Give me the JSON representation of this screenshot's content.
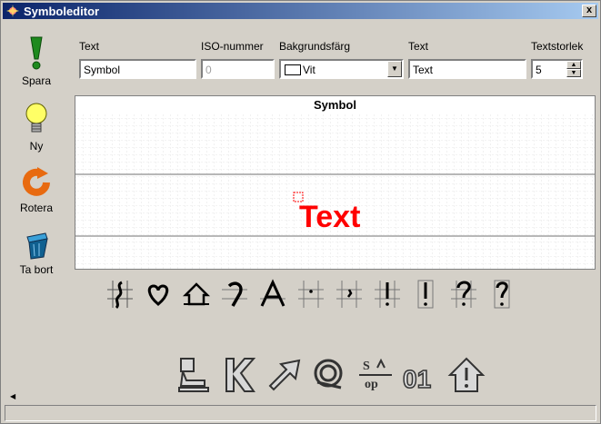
{
  "window": {
    "title": "Symboleditor",
    "close_label": "x"
  },
  "sidebar": {
    "items": [
      {
        "label": "Spara"
      },
      {
        "label": "Ny"
      },
      {
        "label": "Rotera"
      },
      {
        "label": "Ta bort"
      }
    ]
  },
  "fields": {
    "text1": {
      "label": "Text",
      "value": "Symbol"
    },
    "iso": {
      "label": "ISO-nummer",
      "value": "0"
    },
    "background": {
      "label": "Bakgrundsfärg",
      "value": "Vit"
    },
    "text2": {
      "label": "Text",
      "value": "Text"
    },
    "textsize": {
      "label": "Textstorlek",
      "value": "5"
    }
  },
  "canvas": {
    "title": "Symbol",
    "preview_text": "Text",
    "preview_color": "#ff0000"
  },
  "symbols": [
    "symbol-1",
    "symbol-2",
    "symbol-3",
    "symbol-4",
    "symbol-5",
    "symbol-6",
    "symbol-7",
    "symbol-8",
    "symbol-9",
    "symbol-10",
    "symbol-11"
  ],
  "colors": {
    "title_start": "#0a246a",
    "title_end": "#a6caf0",
    "window_bg": "#d4d0c8"
  }
}
